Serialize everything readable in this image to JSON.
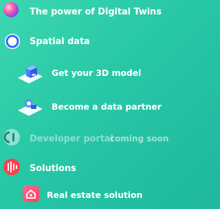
{
  "menu": {
    "items": [
      {
        "label": "The power of Digital Twins",
        "icon": "orb-icon"
      },
      {
        "label": "Spatial data",
        "icon": "ring-icon"
      },
      {
        "label": "Get your 3D model",
        "icon": "3d-model-icon"
      },
      {
        "label": "Become a data partner",
        "icon": "data-partner-icon"
      },
      {
        "label": "Developer portal",
        "icon": "developer-portal-icon",
        "badge": "coming soon"
      },
      {
        "label": "Solutions",
        "icon": "solutions-icon"
      },
      {
        "label": "Real estate solution",
        "icon": "real-estate-icon"
      }
    ]
  },
  "colors": {
    "background_start": "#3cd7b0",
    "background_end": "#1fb89e",
    "text": "#ffffff",
    "ring_blue": "#2f6bff",
    "solutions_red": "#ff3f4e",
    "real_estate_pink": "#ff4f7a"
  }
}
